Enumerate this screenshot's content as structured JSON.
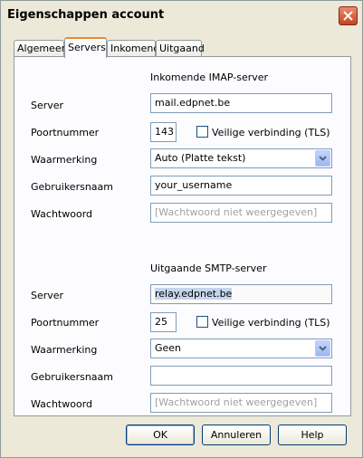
{
  "window": {
    "title": "Eigenschappen account"
  },
  "tabs": [
    {
      "label": "Algemeen",
      "active": false
    },
    {
      "label": "Servers",
      "active": true
    },
    {
      "label": "Inkomend",
      "active": false
    },
    {
      "label": "Uitgaand",
      "active": false
    }
  ],
  "incoming": {
    "heading": "Inkomende IMAP-server",
    "server_label": "Server",
    "server_value": "mail.edpnet.be",
    "port_label": "Poortnummer",
    "port_value": "143",
    "tls_label": "Veilige verbinding (TLS)",
    "tls_checked": false,
    "auth_label": "Waarmerking",
    "auth_value": "Auto  (Platte tekst)",
    "username_label": "Gebruikersnaam",
    "username_value": "your_username",
    "password_label": "Wachtwoord",
    "password_placeholder": "[Wachtwoord niet weergegeven]"
  },
  "outgoing": {
    "heading": "Uitgaande SMTP-server",
    "server_label": "Server",
    "server_value": "relay.edpnet.be",
    "port_label": "Poortnummer",
    "port_value": "25",
    "tls_label": "Veilige verbinding (TLS)",
    "tls_checked": false,
    "auth_label": "Waarmerking",
    "auth_value": "Geen",
    "username_label": "Gebruikersnaam",
    "username_value": "",
    "password_label": "Wachtwoord",
    "password_placeholder": "[Wachtwoord niet weergegeven]"
  },
  "buttons": {
    "ok": "OK",
    "cancel": "Annuleren",
    "help": "Help"
  },
  "colors": {
    "title_bg": "#ece9d8",
    "close": "#c4431f",
    "tab_accent": "#e68b2c",
    "field_border": "#7f9db9"
  }
}
